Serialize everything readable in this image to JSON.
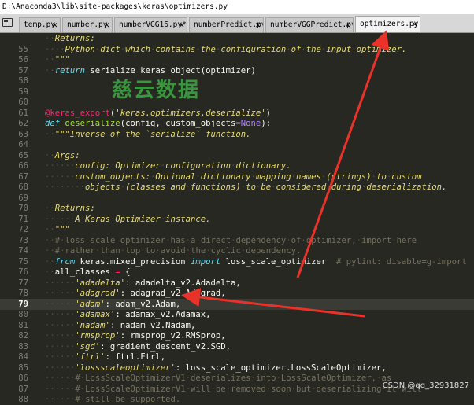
{
  "window": {
    "title": "D:\\Anaconda3\\lib\\site-packages\\keras\\optimizers.py"
  },
  "tabs": [
    {
      "label": "temp.py",
      "dirty": false,
      "active": false
    },
    {
      "label": "number.py",
      "dirty": false,
      "active": false
    },
    {
      "label": "numberVGG16.py",
      "dirty": true,
      "active": false
    },
    {
      "label": "numberPredict.py",
      "dirty": false,
      "active": false
    },
    {
      "label": "numberVGGPredict.py",
      "dirty": false,
      "active": false
    },
    {
      "label": "optimizers.py",
      "dirty": false,
      "active": true
    }
  ],
  "editor": {
    "current_line": 79,
    "lines": [
      {
        "n": "",
        "code": "  Returns:"
      },
      {
        "n": "55",
        "code": "    Python dict which contains the configuration of the input optimizer."
      },
      {
        "n": "56",
        "code": "  \"\"\""
      },
      {
        "n": "57",
        "code": "  return serialize_keras_object(optimizer)"
      },
      {
        "n": "58",
        "code": ""
      },
      {
        "n": "59",
        "code": ""
      },
      {
        "n": "60",
        "code": ""
      },
      {
        "n": "61",
        "code": "@keras_export('keras.optimizers.deserialize')"
      },
      {
        "n": "62",
        "code": "def deserialize(config, custom_objects=None):"
      },
      {
        "n": "63",
        "code": "  \"\"\"Inverse of the `serialize` function."
      },
      {
        "n": "64",
        "code": ""
      },
      {
        "n": "65",
        "code": "  Args:"
      },
      {
        "n": "66",
        "code": "      config: Optimizer configuration dictionary."
      },
      {
        "n": "67",
        "code": "      custom_objects: Optional dictionary mapping names (strings) to custom"
      },
      {
        "n": "68",
        "code": "        objects (classes and functions) to be considered during deserialization."
      },
      {
        "n": "69",
        "code": ""
      },
      {
        "n": "70",
        "code": "  Returns:"
      },
      {
        "n": "71",
        "code": "      A Keras Optimizer instance."
      },
      {
        "n": "72",
        "code": "  \"\"\""
      },
      {
        "n": "73",
        "code": "  # loss_scale_optimizer has a direct dependency of optimizer, import here"
      },
      {
        "n": "74",
        "code": "  # rather than top to avoid the cyclic dependency."
      },
      {
        "n": "75",
        "code": "  from keras.mixed_precision import loss_scale_optimizer  # pylint: disable=g-import"
      },
      {
        "n": "76",
        "code": "  all_classes = {"
      },
      {
        "n": "77",
        "code": "      'adadelta': adadelta_v2.Adadelta,"
      },
      {
        "n": "78",
        "code": "      'adagrad': adagrad_v2.Adagrad,"
      },
      {
        "n": "79",
        "code": "      'adam': adam_v2.Adam,"
      },
      {
        "n": "80",
        "code": "      'adamax': adamax_v2.Adamax,"
      },
      {
        "n": "81",
        "code": "      'nadam': nadam_v2.Nadam,"
      },
      {
        "n": "82",
        "code": "      'rmsprop': rmsprop_v2.RMSprop,"
      },
      {
        "n": "83",
        "code": "      'sgd': gradient_descent_v2.SGD,"
      },
      {
        "n": "84",
        "code": "      'ftrl': ftrl.Ftrl,"
      },
      {
        "n": "85",
        "code": "      'lossscaleoptimizer': loss_scale_optimizer.LossScaleOptimizer,"
      },
      {
        "n": "86",
        "code": "      # LossScaleOptimizerV1 deserializes into LossScaleOptimizer, as"
      },
      {
        "n": "87",
        "code": "      # LossScaleOptimizerV1 will be removed soon but deserializing it will"
      },
      {
        "n": "88",
        "code": "      # still be supported."
      }
    ]
  },
  "overlay": {
    "watermark": "慈云数据",
    "credit": "CSDN @qq_32931827"
  },
  "colors": {
    "background": "#272822",
    "annotation_arrow": "#e8322a",
    "watermark": "#3da843"
  }
}
